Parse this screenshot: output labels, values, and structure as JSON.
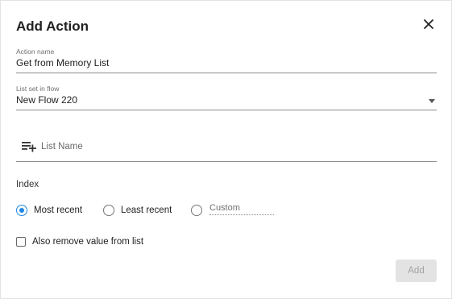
{
  "dialog": {
    "title": "Add Action",
    "close_icon": "close-icon"
  },
  "action_name": {
    "label": "Action name",
    "value": "Get from Memory List"
  },
  "list_set_in_flow": {
    "label": "List set in flow",
    "value": "New Flow 220",
    "dropdown_icon": "caret-down-icon"
  },
  "list_name": {
    "icon": "playlist-add-icon",
    "placeholder": "List Name",
    "value": ""
  },
  "index": {
    "label": "Index",
    "options": [
      {
        "label": "Most recent",
        "selected": true
      },
      {
        "label": "Least recent",
        "selected": false
      },
      {
        "label": "",
        "selected": false
      }
    ],
    "custom_placeholder": "Custom"
  },
  "remove_option": {
    "label": "Also remove value from list",
    "checked": false
  },
  "footer": {
    "add_label": "Add",
    "add_enabled": false
  },
  "colors": {
    "accent": "#1e88e5",
    "disabled_bg": "#e3e3e3",
    "disabled_text": "#a3a3a3"
  }
}
